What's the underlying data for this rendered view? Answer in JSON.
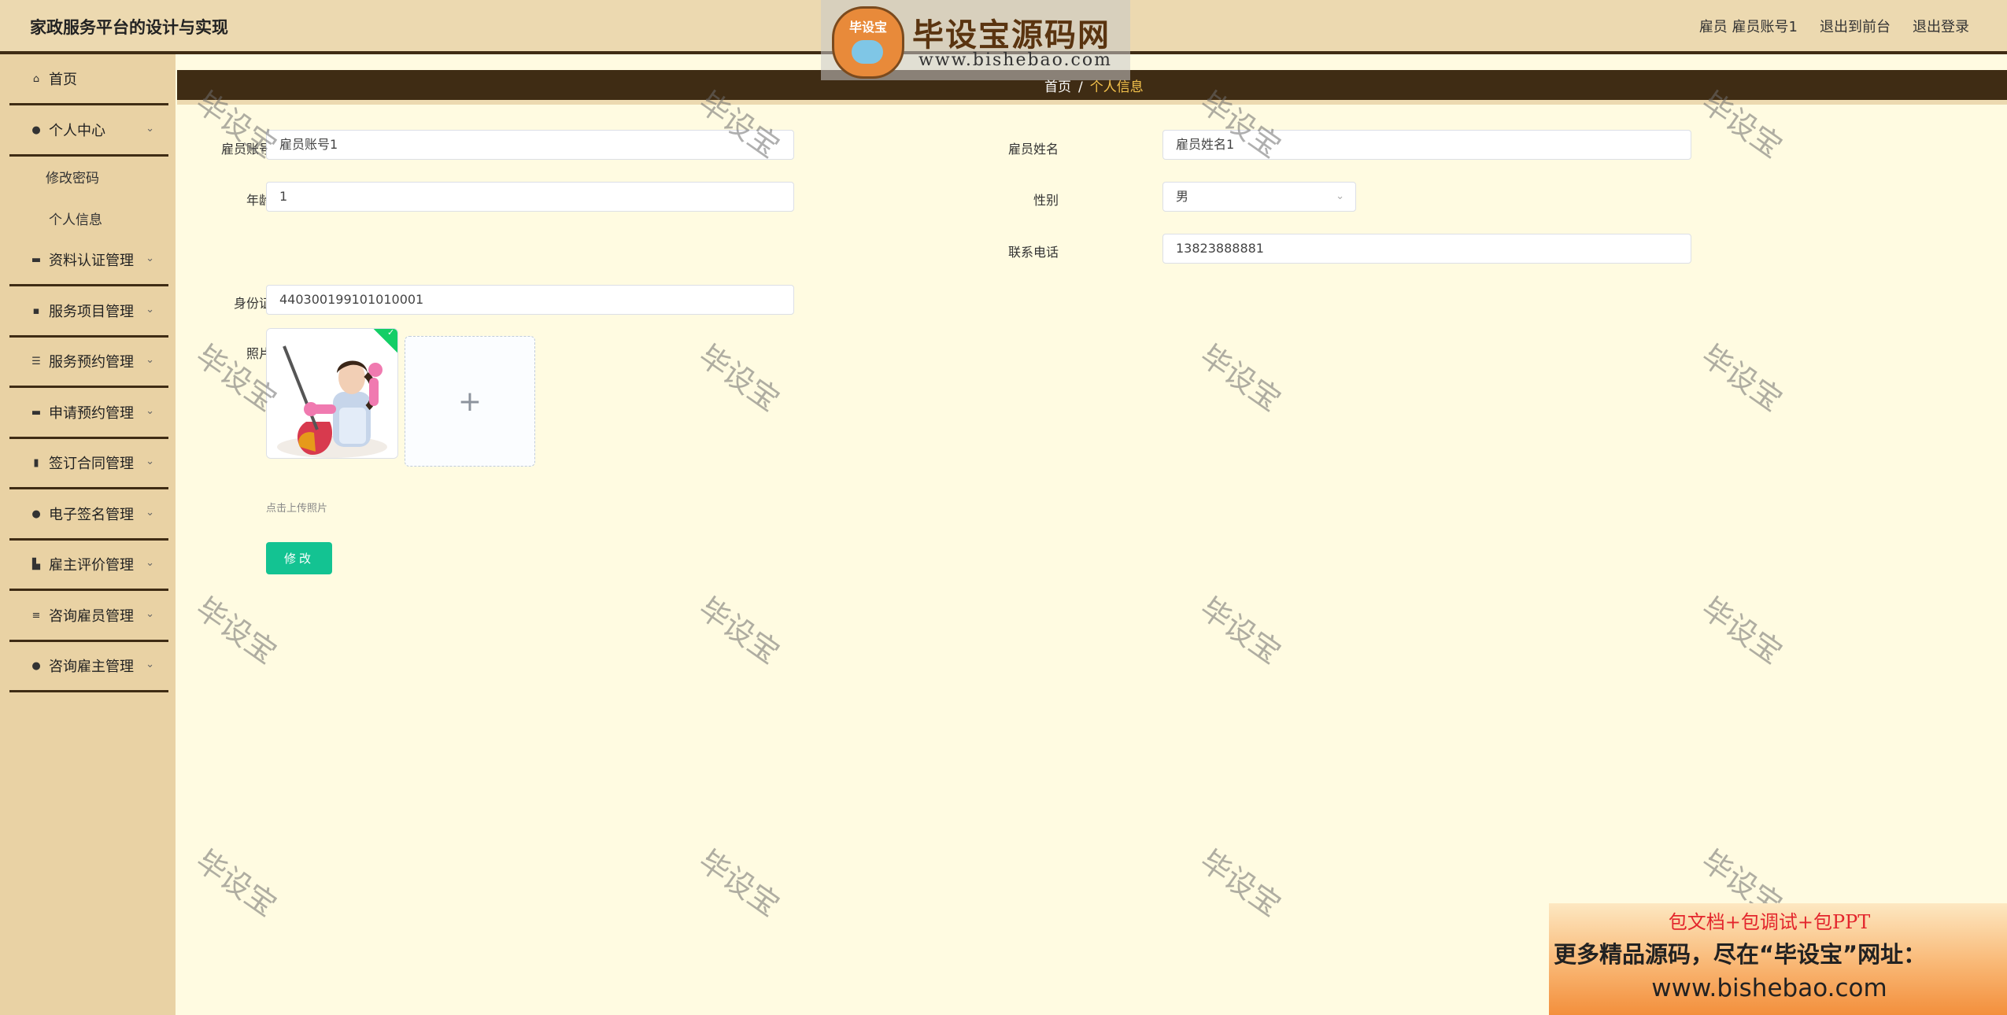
{
  "header": {
    "title": "家政服务平台的设计与实现",
    "user": "雇员 雇员账号1",
    "to_front": "退出到前台",
    "logout": "退出登录"
  },
  "sidebar": {
    "items": [
      {
        "label": "首页",
        "icon": "home-icon"
      },
      {
        "label": "个人中心",
        "icon": "user-icon"
      },
      {
        "label": "资料认证管理",
        "icon": "document-icon"
      },
      {
        "label": "服务项目管理",
        "icon": "chat-icon"
      },
      {
        "label": "服务预约管理",
        "icon": "sliders-icon"
      },
      {
        "label": "申请预约管理",
        "icon": "monitor-icon"
      },
      {
        "label": "签订合同管理",
        "icon": "books-icon"
      },
      {
        "label": "电子签名管理",
        "icon": "pin-icon"
      },
      {
        "label": "雇主评价管理",
        "icon": "rating-icon"
      },
      {
        "label": "咨询雇员管理",
        "icon": "list-icon"
      },
      {
        "label": "咨询雇主管理",
        "icon": "user-icon"
      }
    ],
    "submenu": [
      {
        "label": "修改密码"
      },
      {
        "label": "个人信息"
      }
    ]
  },
  "breadcrumb": {
    "home": "首页",
    "separator": "/",
    "current": "个人信息"
  },
  "form": {
    "account_label": "雇员账号",
    "account_value": "雇员账号1",
    "name_label": "雇员姓名",
    "name_value": "雇员姓名1",
    "age_label": "年龄",
    "age_value": "1",
    "gender_label": "性别",
    "gender_value": "男",
    "phone_label": "联系电话",
    "phone_value": "13823888881",
    "idcard_label": "身份证",
    "idcard_value": "440300199101010001",
    "photo_label": "照片",
    "upload_plus": "+",
    "upload_hint": "点击上传照片",
    "submit_label": "修改",
    "ok_mark": "✓"
  },
  "watermark": {
    "logo_badge": "毕设宝",
    "logo_title": "毕设宝源码网",
    "logo_url": "www.bishebao.com",
    "tile_text": "毕设宝"
  },
  "promo": {
    "line1": "包文档+包调试+包PPT",
    "line2": "更多精品源码，尽在“毕设宝”网址：",
    "line3": "www.bishebao.com"
  },
  "colors": {
    "header_bg": "#ecd9b0",
    "sidebar_bg": "#e9d2a4",
    "content_bg": "#fffbe1",
    "dark_brown": "#3f2c14",
    "crumb_current": "#f5c34c",
    "submit_green": "#13c392",
    "success_green": "#13ce66"
  }
}
